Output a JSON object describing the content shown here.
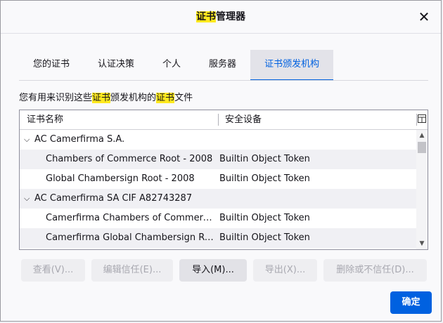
{
  "dialog": {
    "title_highlight": "证书",
    "title_rest": "管理器",
    "close_label": "✕"
  },
  "tabs": [
    {
      "label": "您的证书"
    },
    {
      "label": "认证决策"
    },
    {
      "label": "个人"
    },
    {
      "label": "服务器"
    },
    {
      "label": "证书颁发机构",
      "selected": true
    }
  ],
  "description": {
    "part1": "您有用来识别这些",
    "hl1": "证书",
    "part2": "颁发机构的",
    "hl2": "证书",
    "part3": "文件"
  },
  "tree": {
    "columns": {
      "name": "证书名称",
      "device": "安全设备"
    },
    "picker_icon": "column-picker-icon",
    "rows": [
      {
        "name": "AC Camerfirma S.A.",
        "device": "",
        "group": true,
        "twisty": "⌵"
      },
      {
        "name": "Chambers of Commerce Root - 2008",
        "device": "Builtin Object Token"
      },
      {
        "name": "Global Chambersign Root - 2008",
        "device": "Builtin Object Token"
      },
      {
        "name": "AC Camerfirma SA CIF A82743287",
        "device": "",
        "group": true,
        "twisty": "⌵"
      },
      {
        "name": "Camerfirma Chambers of Commerc...",
        "device": "Builtin Object Token"
      },
      {
        "name": "Camerfirma Global Chambersign Ro...",
        "device": "Builtin Object Token"
      }
    ]
  },
  "buttons": {
    "view": "查看(V)...",
    "edit_trust": "编辑信任(E)...",
    "import": "导入(M)...",
    "export": "导出(X)...",
    "delete_distrust": "删除或不信任(D)...",
    "ok": "确定"
  },
  "colors": {
    "accent": "#0061e0",
    "highlight": "#ffe91f"
  }
}
